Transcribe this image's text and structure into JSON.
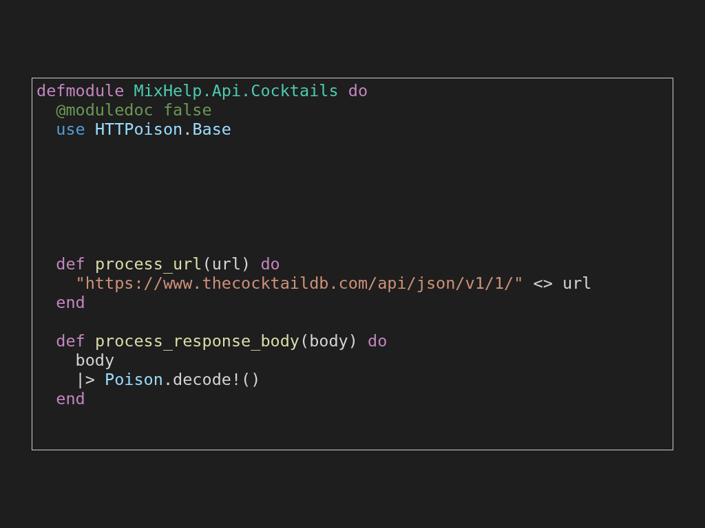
{
  "code_panel": {
    "lines": [
      {
        "kind": "code",
        "tokens": [
          {
            "text": "defmodule ",
            "kind": "keyword"
          },
          {
            "text": "MixHelp.Api.Cocktails ",
            "kind": "module"
          },
          {
            "text": "do",
            "kind": "keyword"
          }
        ],
        "children": [
          {
            "kind": "code",
            "tokens": [
              {
                "text": "@moduledoc false",
                "kind": "attribute"
              }
            ]
          },
          {
            "kind": "code",
            "tokens": [
              {
                "text": "use ",
                "kind": "use"
              },
              {
                "text": "HTTPoison",
                "kind": "alias"
              },
              {
                "text": ".",
                "kind": "plain"
              },
              {
                "text": "Base",
                "kind": "alias"
              }
            ]
          },
          {
            "kind": "blank"
          },
          {
            "kind": "blank"
          },
          {
            "kind": "blank"
          },
          {
            "kind": "blank"
          },
          {
            "kind": "blank"
          },
          {
            "kind": "blank"
          },
          {
            "kind": "code",
            "tokens": [
              {
                "text": "def ",
                "kind": "keyword"
              },
              {
                "text": "process_url",
                "kind": "function"
              },
              {
                "text": "(url) ",
                "kind": "plain"
              },
              {
                "text": "do",
                "kind": "keyword"
              }
            ],
            "children": [
              {
                "kind": "code",
                "tokens": [
                  {
                    "text": "\"https://www.thecocktaildb.com/api/json/v1/1/\"",
                    "kind": "string"
                  },
                  {
                    "text": " <> url",
                    "kind": "plain"
                  }
                ]
              }
            ]
          },
          {
            "kind": "code",
            "tokens": [
              {
                "text": "end",
                "kind": "keyword"
              }
            ]
          },
          {
            "kind": "blank"
          },
          {
            "kind": "code",
            "tokens": [
              {
                "text": "def ",
                "kind": "keyword"
              },
              {
                "text": "process_response_body",
                "kind": "function"
              },
              {
                "text": "(body) ",
                "kind": "plain"
              },
              {
                "text": "do",
                "kind": "keyword"
              }
            ],
            "children": [
              {
                "kind": "code",
                "tokens": [
                  {
                    "text": "body",
                    "kind": "plain"
                  }
                ]
              },
              {
                "kind": "code",
                "tokens": [
                  {
                    "text": "|> ",
                    "kind": "plain"
                  },
                  {
                    "text": "Poison",
                    "kind": "alias"
                  },
                  {
                    "text": ".decode!()",
                    "kind": "plain"
                  }
                ]
              }
            ]
          },
          {
            "kind": "code",
            "tokens": [
              {
                "text": "end",
                "kind": "keyword"
              }
            ]
          }
        ]
      }
    ]
  }
}
